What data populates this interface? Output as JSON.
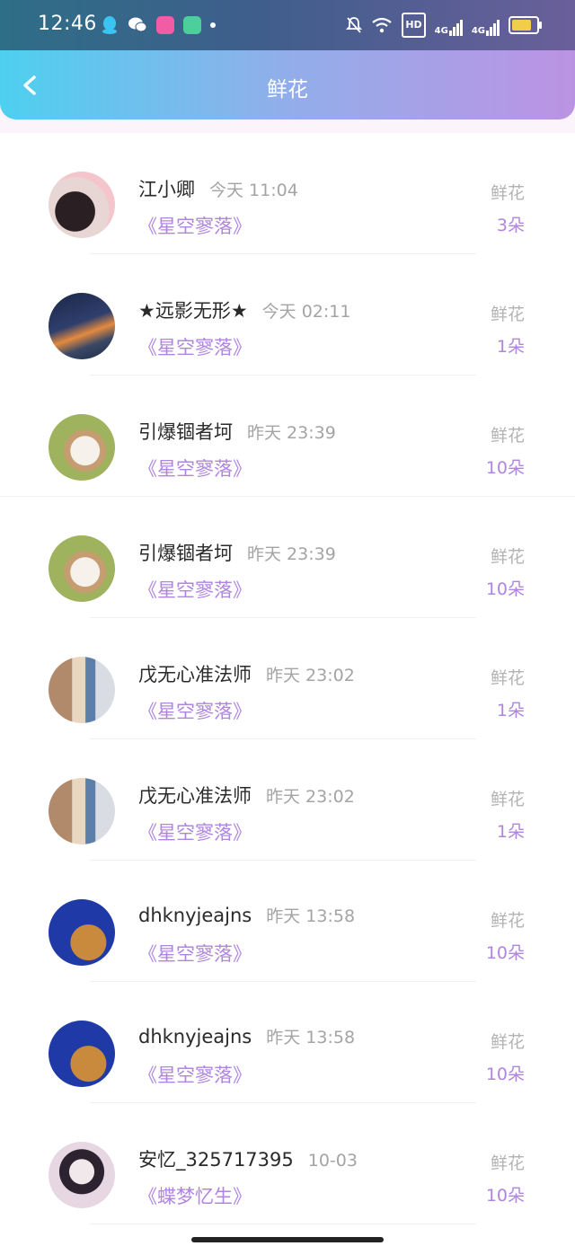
{
  "status_bar": {
    "time": "12:46",
    "hd_label": "HD",
    "signal_1": "4G",
    "signal_2": "4G"
  },
  "header": {
    "title": "鲜花"
  },
  "list": [
    {
      "name": "江小卿",
      "time": "今天 11:04",
      "book": "《星空寥落》",
      "label": "鲜花",
      "count": "3朵"
    },
    {
      "name": "★远影无形★",
      "time": "今天 02:11",
      "book": "《星空寥落》",
      "label": "鲜花",
      "count": "1朵"
    },
    {
      "name": "引爆锢者坷",
      "time": "昨天 23:39",
      "book": "《星空寥落》",
      "label": "鲜花",
      "count": "10朵"
    },
    {
      "name": "引爆锢者坷",
      "time": "昨天 23:39",
      "book": "《星空寥落》",
      "label": "鲜花",
      "count": "10朵"
    },
    {
      "name": "戊无心准法师",
      "time": "昨天 23:02",
      "book": "《星空寥落》",
      "label": "鲜花",
      "count": "1朵"
    },
    {
      "name": "戊无心准法师",
      "time": "昨天 23:02",
      "book": "《星空寥落》",
      "label": "鲜花",
      "count": "1朵"
    },
    {
      "name": "dhknyjeajns",
      "time": "昨天 13:58",
      "book": "《星空寥落》",
      "label": "鲜花",
      "count": "10朵"
    },
    {
      "name": "dhknyjeajns",
      "time": "昨天 13:58",
      "book": "《星空寥落》",
      "label": "鲜花",
      "count": "10朵"
    },
    {
      "name": "安忆_325717395",
      "time": "10-03",
      "book": "《蝶梦忆生》",
      "label": "鲜花",
      "count": "10朵"
    }
  ],
  "colors": {
    "accent_purple": "#b085e0",
    "header_start": "#4dd0ef",
    "header_end": "#bc93e4"
  }
}
